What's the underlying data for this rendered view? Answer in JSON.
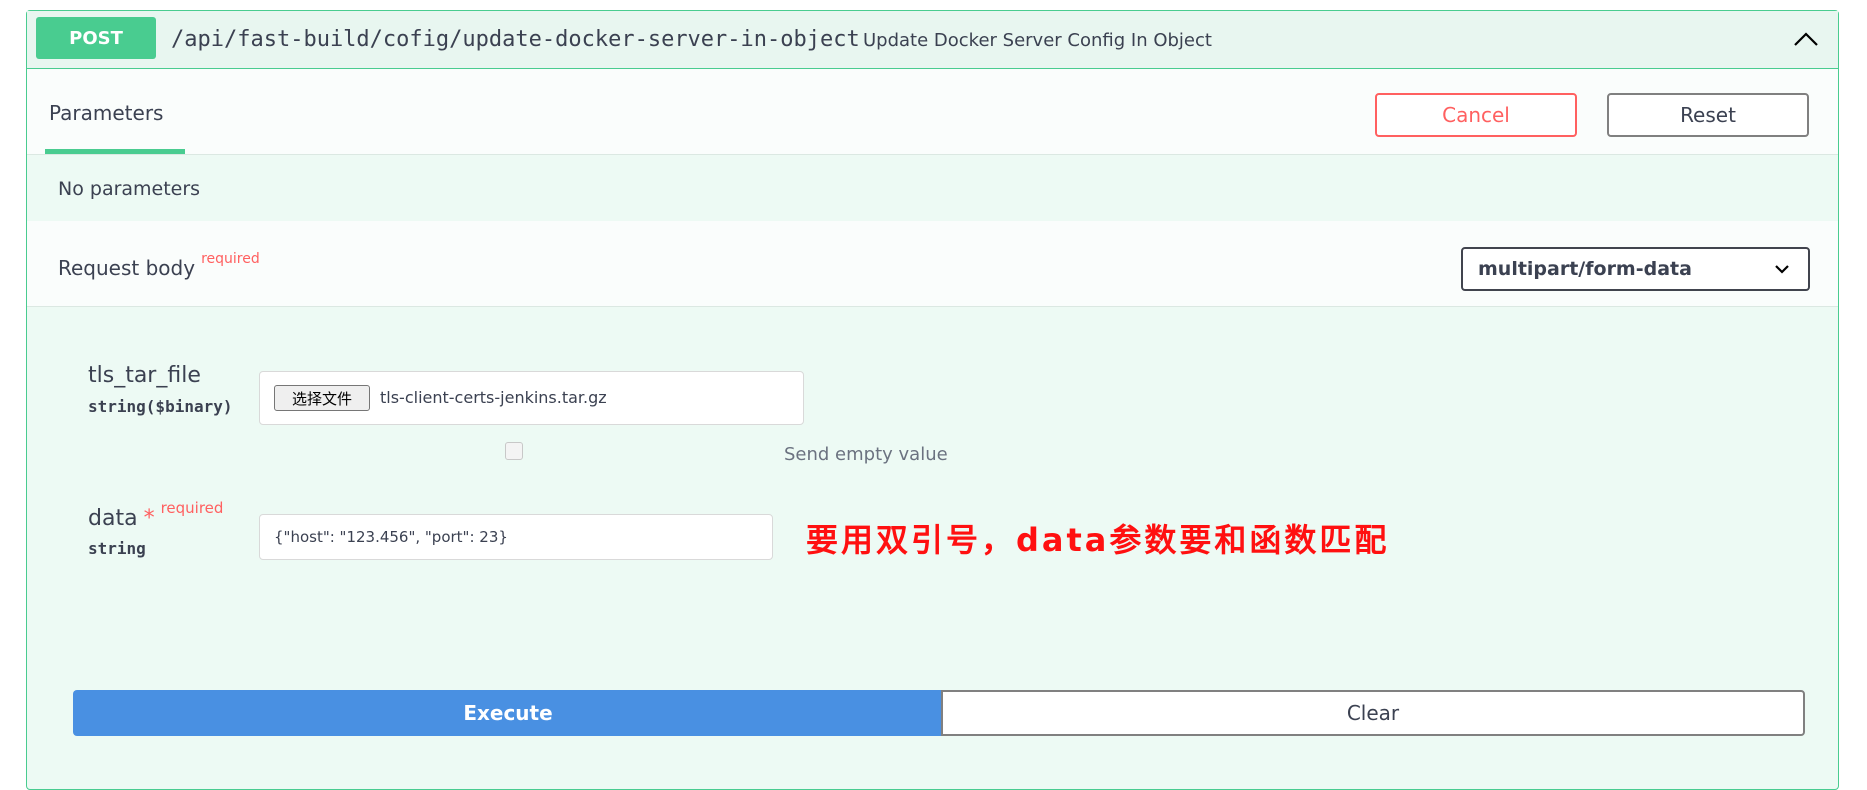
{
  "operation": {
    "method": "POST",
    "path": "/api/fast-build/cofig/update-docker-server-in-object",
    "summary": "Update Docker Server Config In Object"
  },
  "tabs": {
    "parameters_label": "Parameters",
    "cancel_label": "Cancel",
    "reset_label": "Reset"
  },
  "parameters": {
    "empty_text": "No parameters"
  },
  "request_body": {
    "title": "Request body",
    "required_label": "required",
    "content_type": "multipart/form-data"
  },
  "fields": {
    "tls_tar_file": {
      "name": "tls_tar_file",
      "type": "string($binary)",
      "choose_button": "选择文件",
      "file_name": "tls-client-certs-jenkins.tar.gz",
      "send_empty_label": "Send empty value"
    },
    "data": {
      "name": "data",
      "star": "*",
      "required_label": "required",
      "type": "string",
      "value": "{\"host\": \"123.456\", \"port\": 23}"
    }
  },
  "annotation": "要用双引号，data参数要和函数匹配",
  "actions": {
    "execute_label": "Execute",
    "clear_label": "Clear"
  },
  "colors": {
    "post_green": "#49cc90",
    "execute_blue": "#4990e2",
    "cancel_red": "#ff6060",
    "annotation_red": "#ff1010"
  }
}
